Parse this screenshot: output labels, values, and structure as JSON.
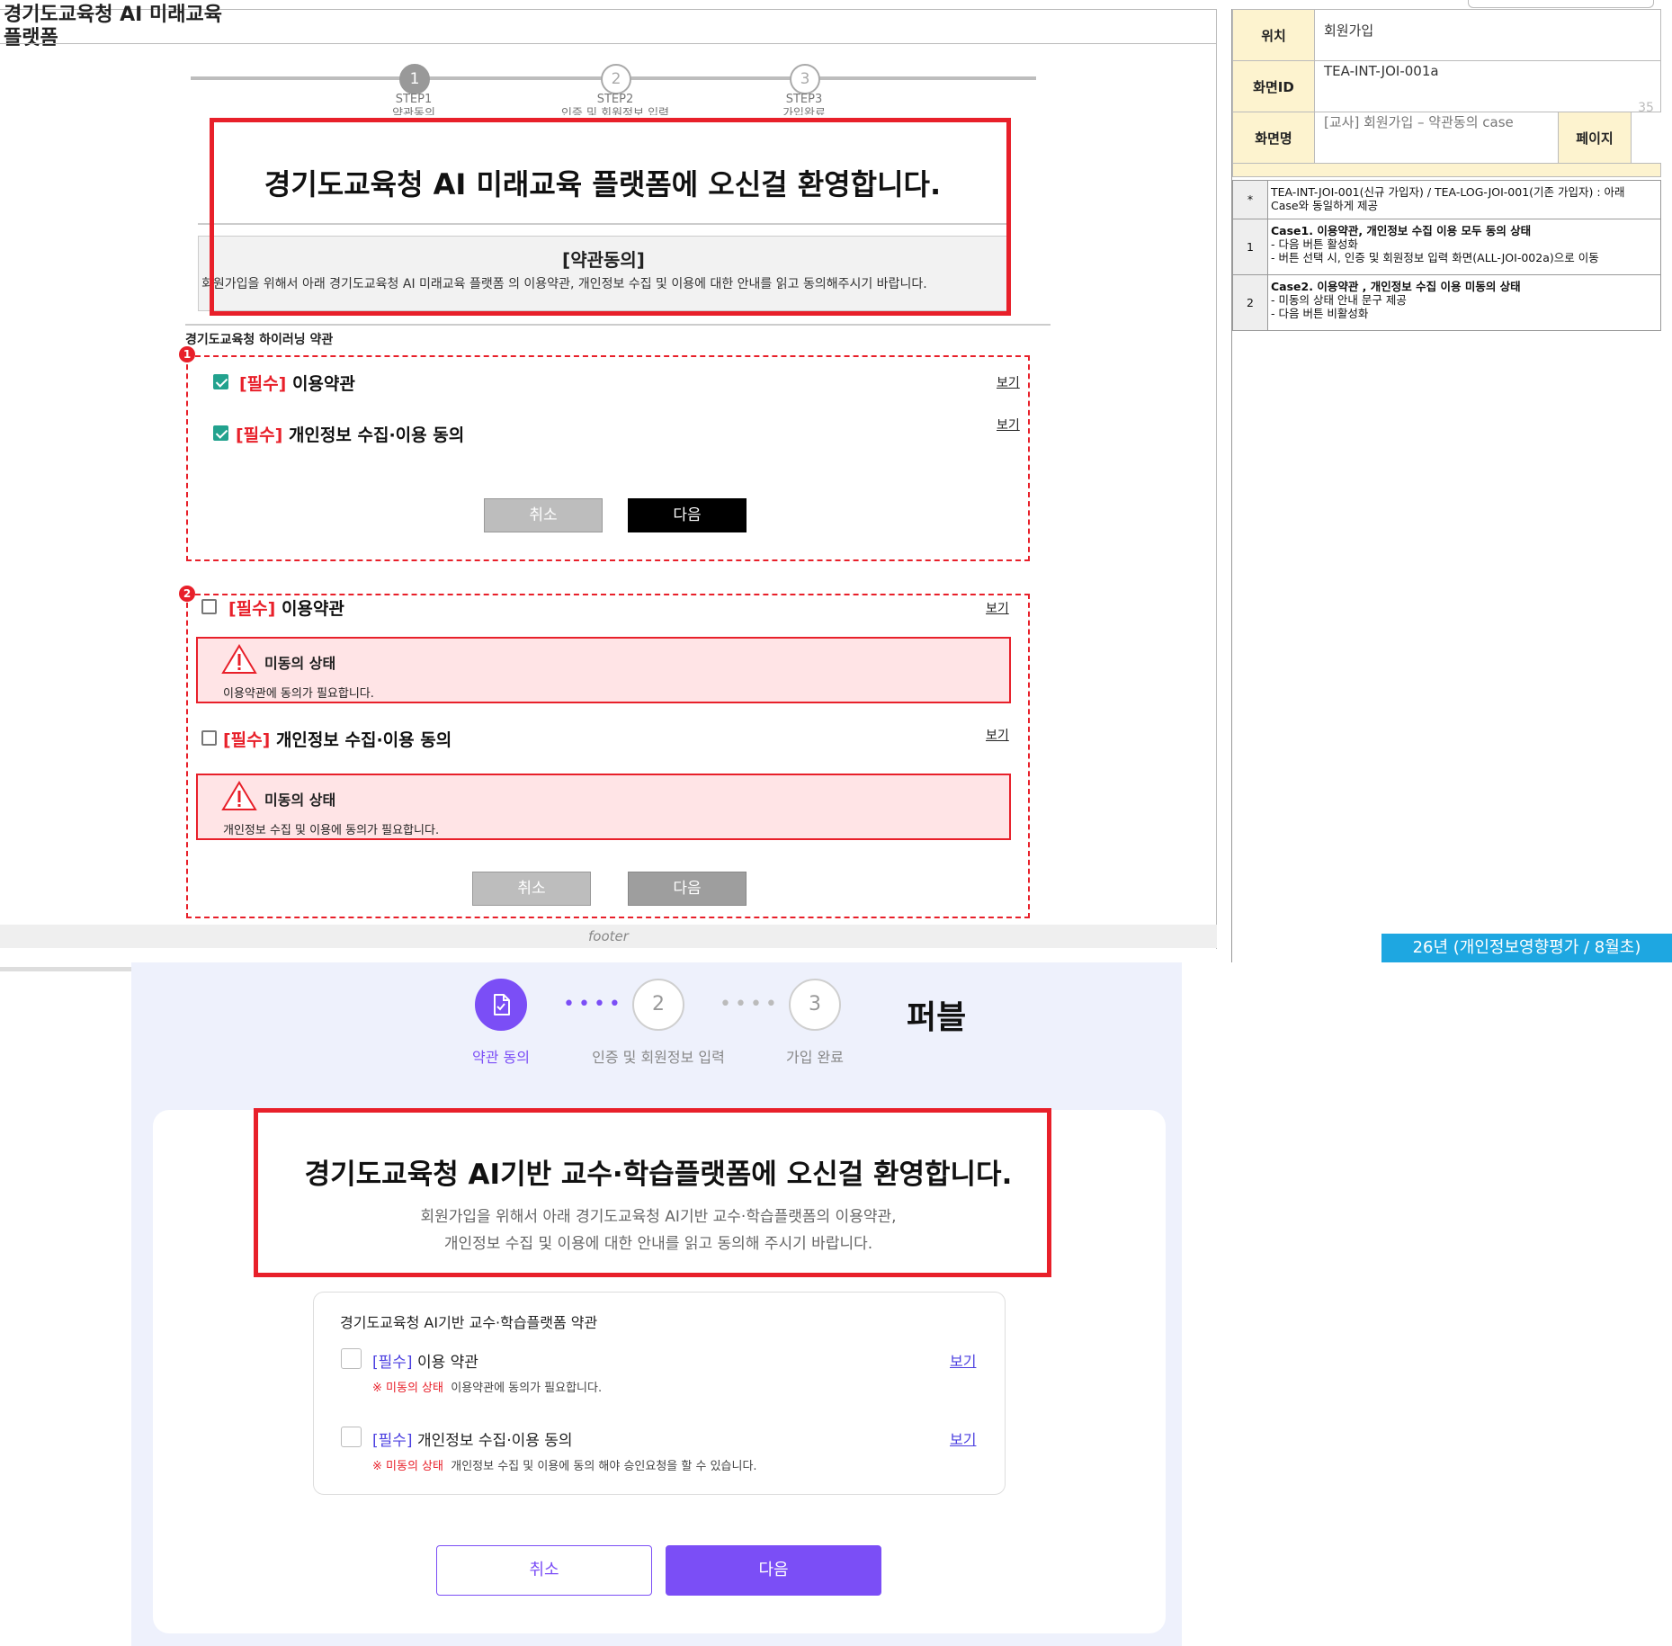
{
  "wireframe": {
    "title_line1": "경기도교육청 AI 미래교육",
    "title_line2": "플랫폼",
    "steps": [
      {
        "num": "1",
        "label1": "STEP1",
        "label2": "약관동의"
      },
      {
        "num": "2",
        "label1": "STEP2",
        "label2": "인증 및 회원정보 입력"
      },
      {
        "num": "3",
        "label1": "STEP3",
        "label2": "가입완료"
      }
    ],
    "welcome": "경기도교육청 AI 미래교육 플랫폼에 오신걸 환영합니다.",
    "agree_title": "[약관동의]",
    "agree_desc": "회원가입을 위해서 아래 경기도교육청 AI 미래교육 플랫폼 의 이용약관, 개인정보 수집 및 이용에 대한 안내를 읽고 동의해주시기 바랍니다.",
    "terms_heading": "경기도교육청 하이러닝 약관",
    "case1": {
      "badge": "1",
      "term1": {
        "req": "[필수]",
        "label": " 이용약관",
        "view": "보기"
      },
      "term2": {
        "req": "[필수]",
        "label": " 개인정보 수집·이용 동의",
        "view": "보기"
      },
      "cancel": "취소",
      "next": "다음"
    },
    "case2": {
      "badge": "2",
      "term1": {
        "req": "[필수]",
        "label": " 이용약관",
        "view": "보기"
      },
      "alert1": {
        "title": "미동의 상태",
        "msg": "이용약관에 동의가 필요합니다."
      },
      "term2": {
        "req": "[필수]",
        "label": " 개인정보 수집·이용 동의",
        "view": "보기"
      },
      "alert2": {
        "title": "미동의 상태",
        "msg": "개인정보 수집 및 이용에 동의가 필요합니다."
      },
      "cancel": "취소",
      "next": "다음"
    },
    "footer": "footer"
  },
  "info_panel": {
    "location_label": "위치",
    "location_value": "회원가입",
    "screen_id_label": "화면ID",
    "screen_id_value": "TEA-INT-JOI-001a",
    "screen_name_label": "화면명",
    "screen_name_value": "[교사] 회원가입 – 약관동의 case",
    "page_label": "페이지",
    "page_value": "35",
    "descriptions": [
      {
        "marker": "*",
        "lines": [
          "TEA-INT-JOI-001(신규 가입자) / TEA-LOG-JOI-001(기존 가입자) : 아래",
          "Case와 동일하게 제공"
        ]
      },
      {
        "marker": "1",
        "lines": [
          "Case1. 이용약관, 개인정보 수집 이용 모두 동의 상태",
          "- 다음 버튼 활성화",
          "- 버튼 선택 시, 인증 및 회원정보 입력 화면(ALL-JOI-002a)으로 이동"
        ]
      },
      {
        "marker": "2",
        "lines": [
          "Case2. 이용약관 , 개인정보 수집 이용  미동의 상태",
          "- 미동의 상태 안내 문구 제공",
          "- 다음 버튼 비활성화"
        ]
      }
    ],
    "schedule_badge": "26년 (개인정보영향평가 / 8월초)"
  },
  "mock": {
    "steps": [
      {
        "num": "",
        "label": "약관 동의",
        "icon": "document-check-icon"
      },
      {
        "num": "2",
        "label": "인증 및 회원정보 입력"
      },
      {
        "num": "3",
        "label": "가입 완료"
      }
    ],
    "brand": "퍼블",
    "welcome": "경기도교육청 AI기반 교수·학습플랫폼에 오신걸 환영합니다.",
    "desc_line1": "회원가입을 위해서 아래 경기도교육청 AI기반 교수·학습플랫폼의 이용약관,",
    "desc_line2": "개인정보 수집 및 이용에 대한 안내를 읽고 동의해 주시기 바랍니다.",
    "terms_heading": "경기도교육청 AI기반 교수·학습플랫폼 약관",
    "term1": {
      "req": "[필수]",
      "label": " 이용 약관",
      "view": "보기",
      "warn_mark": "※ 미동의 상태",
      "warn_msg": "이용약관에 동의가 필요합니다."
    },
    "term2": {
      "req": "[필수]",
      "label": " 개인정보 수집·이용 동의",
      "view": "보기",
      "warn_mark": "※ 미동의 상태",
      "warn_msg": "개인정보 수집 및 이용에 동의 해야 승인요청을 할 수 있습니다."
    },
    "cancel": "취소",
    "next": "다음",
    "colors": {
      "accent": "#7b4ef6",
      "background": "#eef1fc",
      "highlight": "#e8202a"
    }
  }
}
